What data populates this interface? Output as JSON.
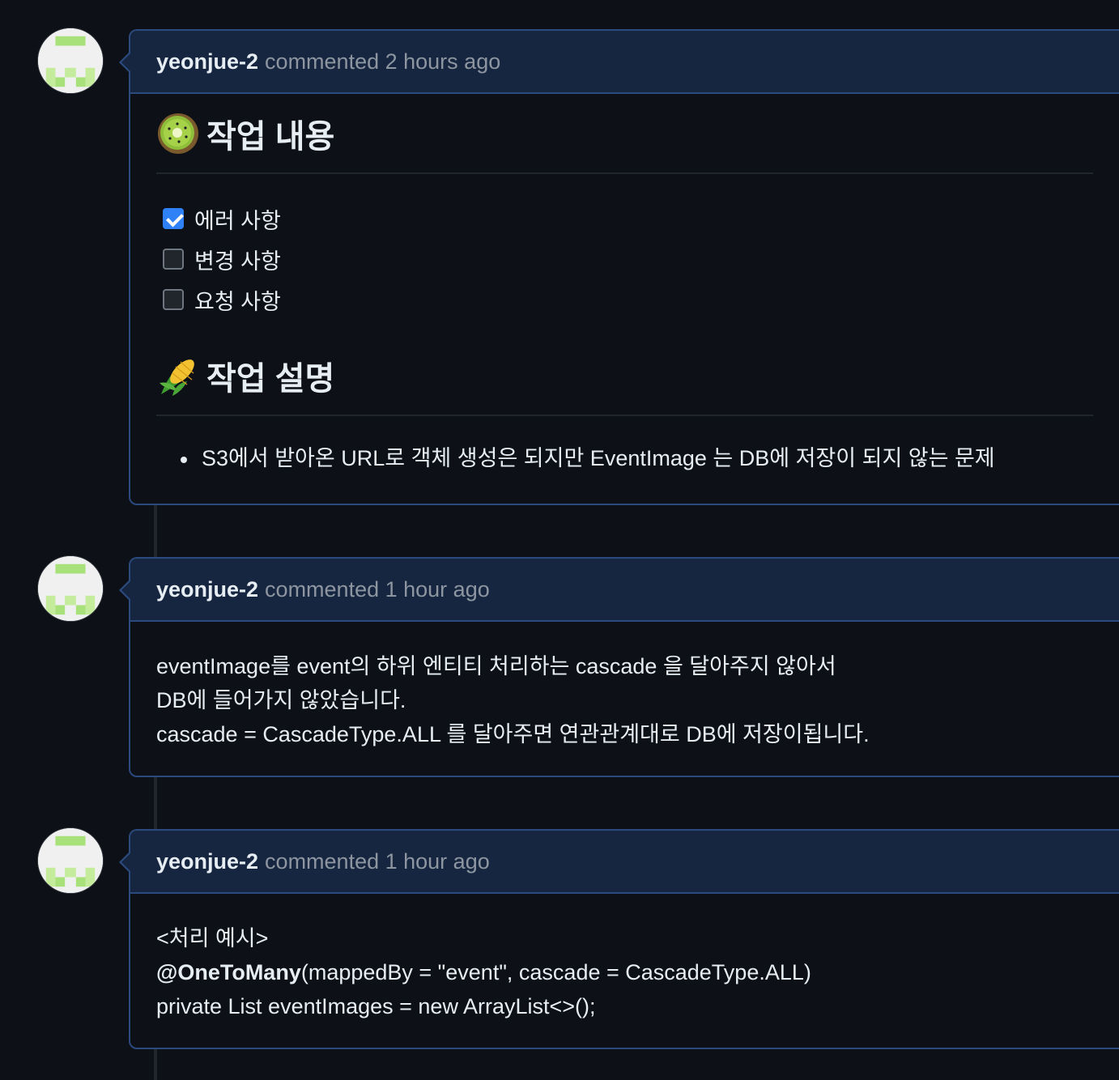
{
  "comments": [
    {
      "author": "yeonjue-2",
      "meta": "commented 2 hours ago",
      "section1": {
        "emoji": "kiwi-emoji",
        "title": "작업 내용"
      },
      "tasks": [
        {
          "label": "에러 사항",
          "checked": true
        },
        {
          "label": "변경 사항",
          "checked": false
        },
        {
          "label": "요청 사항",
          "checked": false
        }
      ],
      "section2": {
        "emoji": "corn-emoji",
        "title": "작업 설명"
      },
      "bullets": [
        "S3에서 받아온 URL로 객체 생성은 되지만 EventImage 는 DB에 저장이 되지 않는 문제"
      ]
    },
    {
      "author": "yeonjue-2",
      "meta": "commented 1 hour ago",
      "lines": [
        "eventImage를 event의 하위 엔티티 처리하는 cascade 을 달아주지 않아서",
        "DB에 들어가지 않았습니다.",
        "cascade = CascadeType.ALL 를 달아주면 연관관계대로 DB에 저장이됩니다."
      ]
    },
    {
      "author": "yeonjue-2",
      "meta": "commented 1 hour ago",
      "lines": [
        "<처리 예시>",
        "(mappedBy = \"event\", cascade = CascadeType.ALL)",
        "private List eventImages = new ArrayList<>();"
      ],
      "annotation": "@OneToMany"
    }
  ],
  "colors": {
    "background": "#0d1117",
    "header": "#172640",
    "border": "#2b4a7e",
    "checkbox_checked": "#2f81f7"
  }
}
